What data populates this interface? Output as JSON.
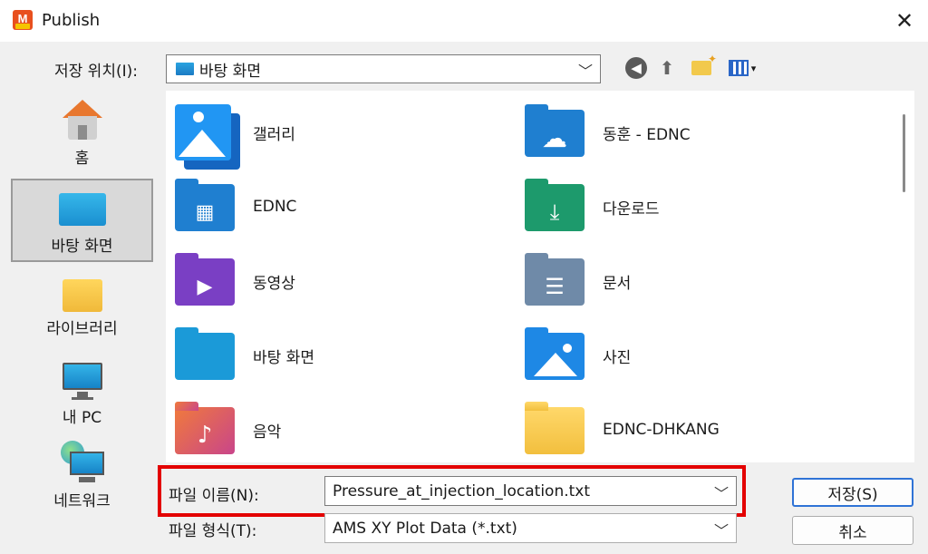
{
  "window": {
    "title": "Publish",
    "close_glyph": "✕"
  },
  "location": {
    "label": "저장 위치(I):",
    "value": "바탕 화면"
  },
  "toolbar": {
    "back_glyph": "◀",
    "up_glyph": "⬆",
    "view_dropdown_glyph": "▾"
  },
  "sidebar": {
    "items": [
      {
        "label": "홈",
        "icon": "home-icon"
      },
      {
        "label": "바탕 화면",
        "icon": "desktop-icon",
        "selected": true
      },
      {
        "label": "라이브러리",
        "icon": "libraries-icon"
      },
      {
        "label": "내 PC",
        "icon": "this-pc-icon"
      },
      {
        "label": "네트워크",
        "icon": "network-icon"
      }
    ]
  },
  "files": [
    {
      "name": "갤러리",
      "icon": "gallery-icon",
      "color": "#1e88e5"
    },
    {
      "name": "동훈 - EDNC",
      "icon": "onedrive-folder-icon",
      "color": "#1f7fd0"
    },
    {
      "name": "EDNC",
      "icon": "building-folder-icon",
      "color": "#1f7fd0"
    },
    {
      "name": "다운로드",
      "icon": "downloads-folder-icon",
      "color": "#1d9a6c"
    },
    {
      "name": "동영상",
      "icon": "videos-folder-icon",
      "color": "#7a3fc4"
    },
    {
      "name": "문서",
      "icon": "documents-folder-icon",
      "color": "#6f8aa8"
    },
    {
      "name": "바탕 화면",
      "icon": "desktop-folder-icon",
      "color": "#1b9ad8"
    },
    {
      "name": "사진",
      "icon": "pictures-folder-icon",
      "color": "#1e88e5"
    },
    {
      "name": "음악",
      "icon": "music-folder-icon",
      "color": "#e0624a"
    },
    {
      "name": "EDNC-DHKANG",
      "icon": "folder-icon",
      "color": "#f5c542"
    }
  ],
  "form": {
    "filename_label": "파일 이름(N):",
    "filename_value": "Pressure_at_injection_location.txt",
    "filetype_label": "파일 형식(T):",
    "filetype_value": "AMS XY Plot Data (*.txt)",
    "dropdown_glyph": "﹀"
  },
  "buttons": {
    "save": "저장(S)",
    "cancel": "취소"
  },
  "colors": {
    "highlight_box": "#e30000",
    "primary_button_border": "#2f73d6"
  }
}
